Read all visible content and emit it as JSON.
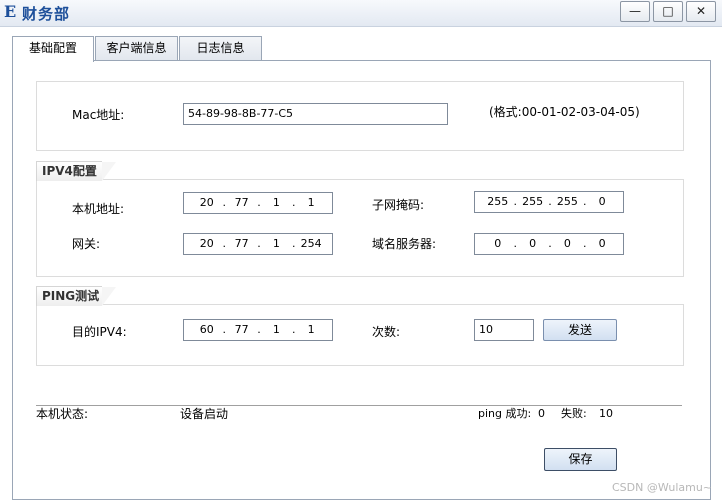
{
  "window": {
    "title": "财务部",
    "app_icon_glyph": "E",
    "controls": {
      "minimize": "—",
      "maximize": "□",
      "close": "✕"
    }
  },
  "tabs": [
    {
      "label": "基础配置",
      "active": true
    },
    {
      "label": "客户端信息",
      "active": false
    },
    {
      "label": "日志信息",
      "active": false
    }
  ],
  "mac": {
    "label": "Mac地址:",
    "value": "54-89-98-8B-77-C5",
    "format_hint": "(格式:00-01-02-03-04-05)"
  },
  "ipv4": {
    "group_title": "IPV4配置",
    "local_address": {
      "label": "本机地址:",
      "octets": [
        "20",
        "77",
        "1",
        "1"
      ]
    },
    "subnet_mask": {
      "label": "子网掩码:",
      "octets": [
        "255",
        "255",
        "255",
        "0"
      ]
    },
    "gateway": {
      "label": "网关:",
      "octets": [
        "20",
        "77",
        "1",
        "254"
      ]
    },
    "dns": {
      "label": "域名服务器:",
      "octets": [
        "0",
        "0",
        "0",
        "0"
      ]
    }
  },
  "ping": {
    "group_title": "PING测试",
    "target": {
      "label": "目的IPV4:",
      "octets": [
        "60",
        "77",
        "1",
        "1"
      ]
    },
    "count": {
      "label": "次数:",
      "value": "10"
    },
    "send_label": "发送"
  },
  "status": {
    "label": "本机状态:",
    "value": "设备启动",
    "ping_success_label": "ping 成功:",
    "ping_success_value": "0",
    "fail_label": "失败:",
    "fail_value": "10"
  },
  "save_label": "保存",
  "watermark": "CSDN @Wulamu~"
}
